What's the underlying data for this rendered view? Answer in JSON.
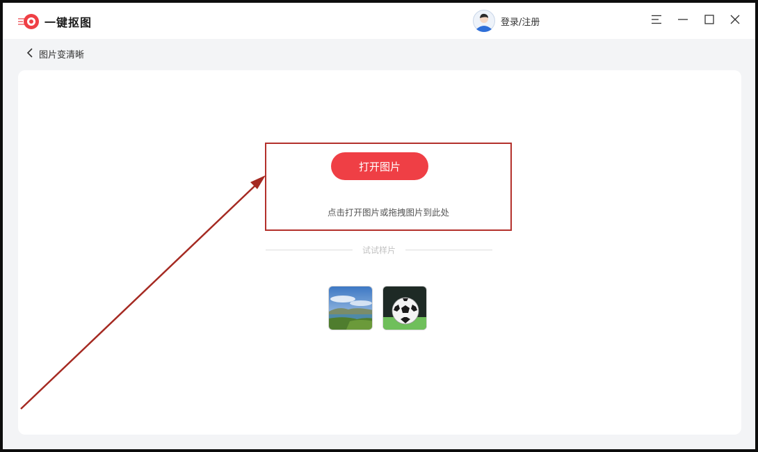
{
  "app": {
    "name": "一键抠图",
    "logo_icon": "logo-icon",
    "accent_color": "#ef3f45"
  },
  "titlebar": {
    "user_label": "登录/注册",
    "avatar_icon": "user-avatar-icon",
    "menu_icon": "menu-icon",
    "minimize_icon": "minimize-icon",
    "maximize_icon": "maximize-icon",
    "close_icon": "close-icon"
  },
  "breadcrumb": {
    "back_icon": "chevron-left-icon",
    "label": "图片变清晰"
  },
  "main": {
    "open_button_label": "打开图片",
    "drop_hint": "点击打开图片或拖拽图片到此处",
    "samples_label": "试试样片",
    "samples": [
      {
        "name": "landscape-sample",
        "icon": "landscape-thumbnail"
      },
      {
        "name": "soccer-ball-sample",
        "icon": "soccer-ball-thumbnail"
      }
    ]
  },
  "annotation": {
    "highlight_color": "#b3302b",
    "arrow_color": "#a52a22"
  }
}
